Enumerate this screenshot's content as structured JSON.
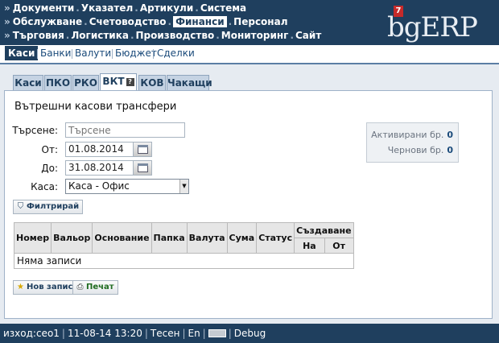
{
  "header": {
    "menu_rows": [
      [
        "Документи",
        "Указател",
        "Артикули",
        "Система"
      ],
      [
        "Обслужване",
        "Счетоводство",
        "Финанси",
        "Персонал"
      ],
      [
        "Търговия",
        "Логистика",
        "Производство",
        "Мониторинг",
        "Сайт"
      ]
    ],
    "active_menu": "Финанси",
    "logo_text": "bgERP",
    "logo_badge": "7"
  },
  "subnav": {
    "items": [
      "Каси",
      "Банки",
      "Валути",
      "Бюджет",
      "Сделки"
    ],
    "active": "Каси"
  },
  "tabs": {
    "items": [
      "Каси",
      "ПКО",
      "РКО",
      "ВКТ",
      "КОВ",
      "Чакащи"
    ],
    "active": "ВКТ",
    "help_icon": "question-icon"
  },
  "page": {
    "title": "Вътрешни касови трансфери"
  },
  "filter": {
    "search_label": "Търсене:",
    "search_placeholder": "Търсене",
    "from_label": "От:",
    "from_value": "01.08.2014",
    "to_label": "До:",
    "to_value": "31.08.2014",
    "cashbox_label": "Каса:",
    "cashbox_value": "Каса - Офис",
    "filter_button": "Филтрирай"
  },
  "stats": {
    "active_label": "Активирани бр.",
    "active_count": "0",
    "draft_label": "Чернови бр.",
    "draft_count": "0"
  },
  "table": {
    "headers": [
      "Номер",
      "Вальор",
      "Основание",
      "Папка",
      "Валута",
      "Сума",
      "Статус"
    ],
    "created_group": "Създаване",
    "created_sub": [
      "На",
      "От"
    ],
    "empty_text": "Няма записи"
  },
  "actions": {
    "new_record": "Нов запис",
    "print": "Печат"
  },
  "footer": {
    "user": "изход:сео1",
    "datetime": "11-08-14 13:20",
    "view_mode": "Тесен",
    "language": "En",
    "debug": "Debug"
  },
  "colors": {
    "header_bg": "#1f3f5e",
    "accent": "#5b7ea5",
    "badge_red": "#c62a2a",
    "count_blue": "#1a4a7a"
  }
}
